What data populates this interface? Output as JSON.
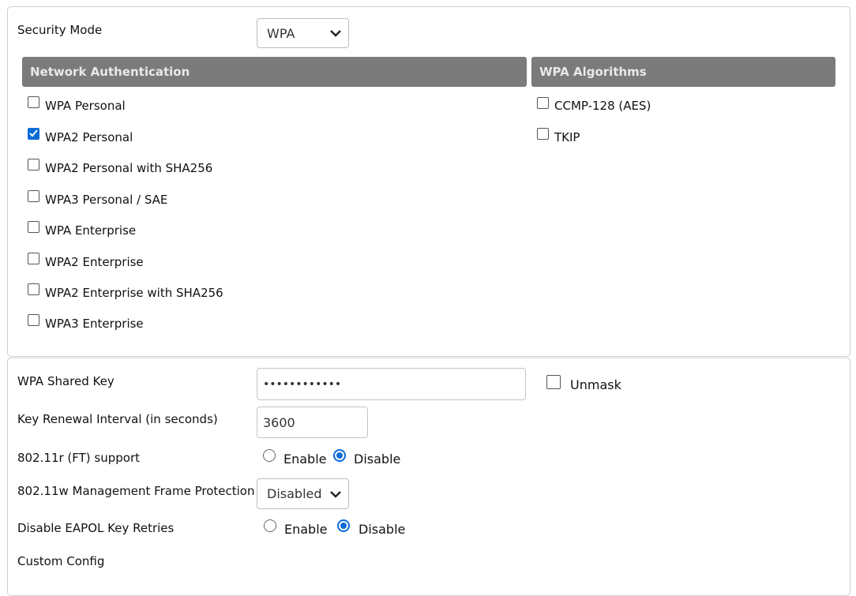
{
  "security_mode": {
    "label": "Security Mode",
    "value": "WPA"
  },
  "network_auth": {
    "header": "Network Authentication",
    "options": [
      {
        "label": "WPA Personal",
        "checked": false
      },
      {
        "label": "WPA2 Personal",
        "checked": true
      },
      {
        "label": "WPA2 Personal with SHA256",
        "checked": false
      },
      {
        "label": "WPA3 Personal / SAE",
        "checked": false
      },
      {
        "label": "WPA Enterprise",
        "checked": false
      },
      {
        "label": "WPA2 Enterprise",
        "checked": false
      },
      {
        "label": "WPA2 Enterprise with SHA256",
        "checked": false
      },
      {
        "label": "WPA3 Enterprise",
        "checked": false
      }
    ]
  },
  "wpa_algorithms": {
    "header": "WPA Algorithms",
    "options": [
      {
        "label": "CCMP-128 (AES)",
        "checked": false
      },
      {
        "label": "TKIP",
        "checked": false
      }
    ]
  },
  "shared_key": {
    "label": "WPA Shared Key",
    "value": "••••••••••••",
    "unmask_label": "Unmask",
    "unmask_checked": false
  },
  "key_renewal": {
    "label": "Key Renewal Interval (in seconds)",
    "value": "3600"
  },
  "ft_support": {
    "label": "802.11r (FT) support",
    "enable_label": "Enable",
    "disable_label": "Disable",
    "selected": "Disable"
  },
  "mfp": {
    "label": "802.11w Management Frame Protection",
    "value": "Disabled"
  },
  "eapol": {
    "label": "Disable EAPOL Key Retries",
    "enable_label": "Enable",
    "disable_label": "Disable",
    "selected": "Disable"
  },
  "custom_config": {
    "label": "Custom Config"
  },
  "colors": {
    "accent": "#0a6cd6",
    "header_bg": "#7b7b7b",
    "header_text": "#e9e9e9"
  }
}
